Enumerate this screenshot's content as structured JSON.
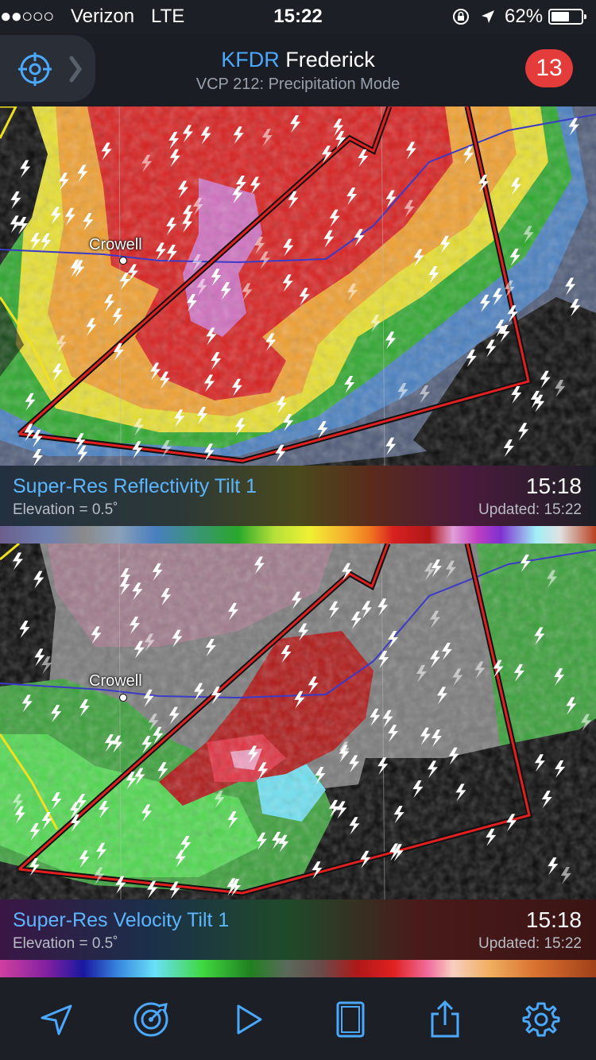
{
  "status_bar": {
    "signal": "●●○○○",
    "carrier": "Verizon",
    "network": "LTE",
    "time": "15:22",
    "battery": "62%",
    "battery_level": 0.62
  },
  "header": {
    "station_id": "KFDR",
    "station_name": "Frederick",
    "vcp": "VCP 212: Precipitation Mode",
    "alert_count": "13",
    "locate_icon": "crosshair-icon",
    "expand_icon": "chevron-right-icon"
  },
  "map": {
    "town": "Crowell"
  },
  "reflectivity": {
    "title": "Super-Res Reflectivity Tilt 1",
    "elevation": "Elevation = 0.5˚",
    "time": "15:18",
    "updated": "Updated: 15:22"
  },
  "velocity": {
    "title": "Super-Res Velocity Tilt 1",
    "elevation": "Elevation = 0.5˚",
    "time": "15:18",
    "updated": "Updated: 15:22"
  },
  "toolbar": {
    "items": [
      "location-arrow-icon",
      "radar-icon",
      "play-icon",
      "layout-icon",
      "share-icon",
      "settings-icon"
    ]
  },
  "colors": {
    "accent": "#4aa8ff",
    "badge": "#e43b3b",
    "warning_polygon": "#e02020",
    "county_line": "#f0e020"
  }
}
